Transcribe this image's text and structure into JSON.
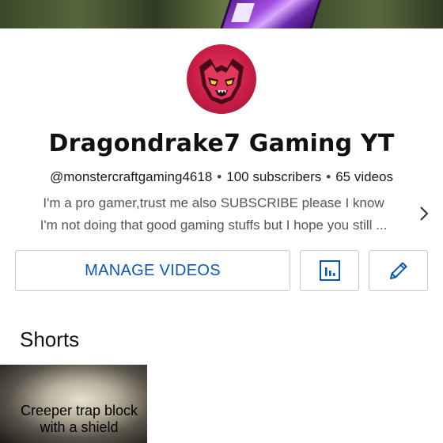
{
  "channel": {
    "name": "Dragondrake7 Gaming YT",
    "handle": "@monstercraftgaming4618",
    "subscribers": "100 subscribers",
    "videos": "65 videos",
    "separator": "•",
    "description_line1": "I'm a pro gamer,trust me also SUBSCRIBE please I know",
    "description_line2": "I'm not doing that good gaming  stuffs but I hope you still ..."
  },
  "actions": {
    "manage_label": "MANAGE VIDEOS",
    "analytics_icon": "bar-chart-icon",
    "edit_icon": "pencil-icon"
  },
  "shorts": {
    "section_title": "Shorts",
    "items": [
      {
        "caption_line1": "Creeper trap block",
        "caption_line2": "with a shield"
      }
    ]
  },
  "colors": {
    "accent_blue": "#0b57b5",
    "avatar_red": "#c81d47",
    "text_primary": "#111111",
    "text_secondary": "#555555",
    "border": "#c9c9c9"
  }
}
